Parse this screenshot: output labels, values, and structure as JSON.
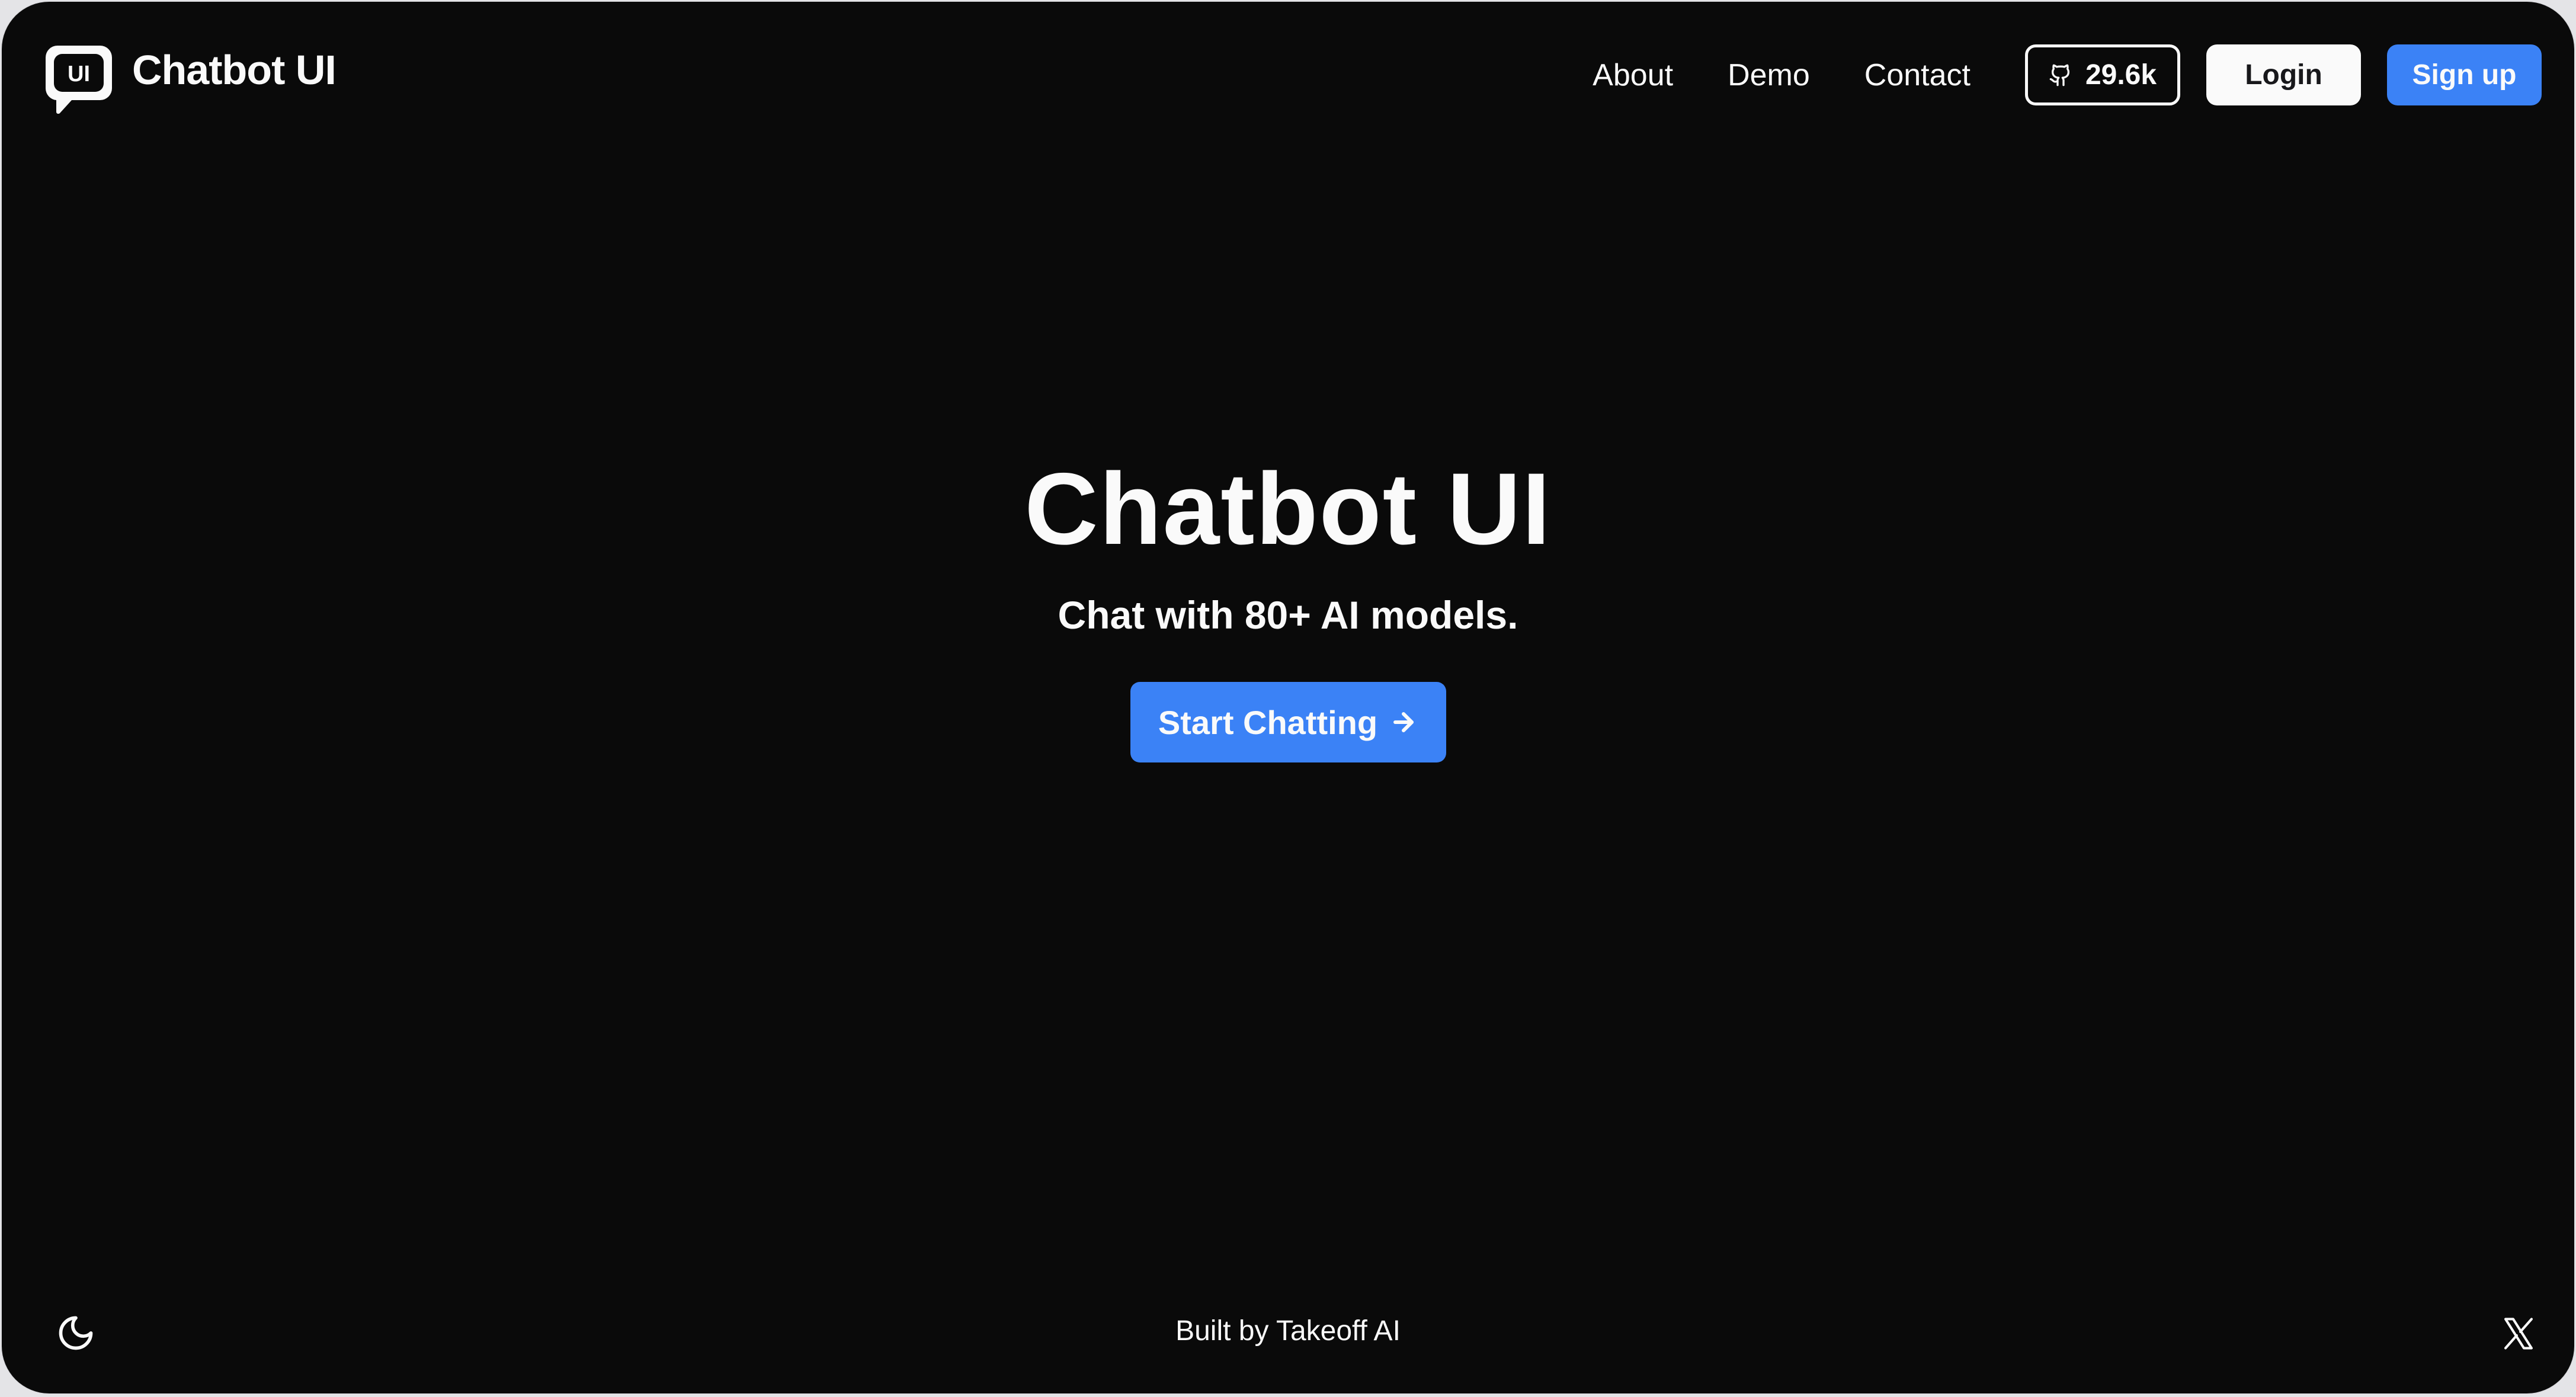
{
  "header": {
    "brand": {
      "logo_icon": "chat-bubble-ui-logo",
      "logo_glyph": "UI",
      "name": "Chatbot UI"
    },
    "nav_links": [
      {
        "label": "About"
      },
      {
        "label": "Demo"
      },
      {
        "label": "Contact"
      }
    ],
    "github_badge": {
      "icon": "github-icon",
      "stars": "29.6k"
    },
    "login_label": "Login",
    "signup_label": "Sign up"
  },
  "hero": {
    "title": "Chatbot UI",
    "subtitle": "Chat with 80+ AI models.",
    "cta": {
      "label": "Start Chatting",
      "icon": "arrow-right-icon"
    }
  },
  "footer": {
    "theme_toggle_icon": "moon-icon",
    "credit": "Built by Takeoff AI",
    "social_icon": "x-twitter-icon"
  },
  "colors": {
    "background": "#0a0a0a",
    "foreground": "#fafafa",
    "accent": "#3b82f6",
    "frame": "#e4e4e7"
  }
}
